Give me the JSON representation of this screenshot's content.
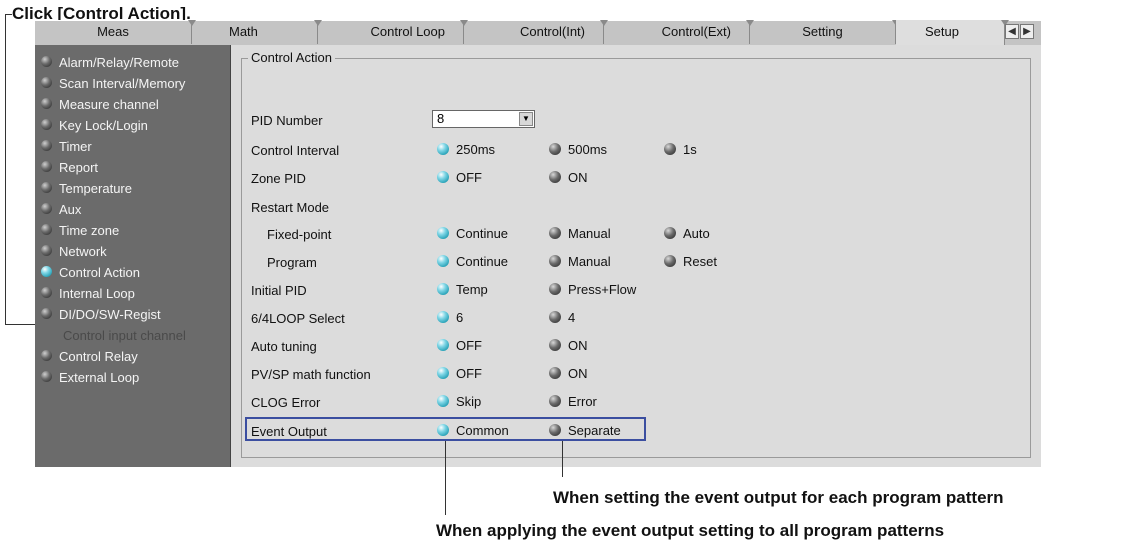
{
  "callouts": {
    "top": "Click [Control Action].",
    "separate": "When setting the event output for each program pattern",
    "common": "When applying the event output setting to all program patterns"
  },
  "tabs": [
    "Meas",
    "Math",
    "Control Loop",
    "Control(Int)",
    "Control(Ext)",
    "Setting",
    "Setup"
  ],
  "active_tab": "Setup",
  "menu": [
    {
      "label": "Alarm/Relay/Remote",
      "on": false
    },
    {
      "label": "Scan Interval/Memory",
      "on": false
    },
    {
      "label": "Measure channel",
      "on": false
    },
    {
      "label": "Key Lock/Login",
      "on": false
    },
    {
      "label": "Timer",
      "on": false
    },
    {
      "label": "Report",
      "on": false
    },
    {
      "label": "Temperature",
      "on": false
    },
    {
      "label": "Aux",
      "on": false
    },
    {
      "label": "Time zone",
      "on": false
    },
    {
      "label": "Network",
      "on": false
    },
    {
      "label": "Control Action",
      "on": true
    },
    {
      "label": "Internal Loop",
      "on": false
    },
    {
      "label": "DI/DO/SW-Regist",
      "on": false
    },
    {
      "label": "Control input channel",
      "disabled": true
    },
    {
      "label": "Control Relay",
      "on": false
    },
    {
      "label": "External Loop",
      "on": false
    }
  ],
  "group_title": "Control Action",
  "pid_number": {
    "label": "PID Number",
    "value": "8"
  },
  "rows": [
    {
      "label": "Control Interval",
      "options": [
        {
          "t": "250ms",
          "on": true
        },
        {
          "t": "500ms",
          "on": false
        },
        {
          "t": "1s",
          "on": false
        }
      ]
    },
    {
      "label": "Zone PID",
      "options": [
        {
          "t": "OFF",
          "on": true
        },
        {
          "t": "ON",
          "on": false
        }
      ]
    },
    {
      "label": "Restart Mode",
      "options": []
    },
    {
      "label": "Fixed-point",
      "indent": true,
      "options": [
        {
          "t": "Continue",
          "on": true
        },
        {
          "t": "Manual",
          "on": false
        },
        {
          "t": "Auto",
          "on": false
        }
      ]
    },
    {
      "label": "Program",
      "indent": true,
      "options": [
        {
          "t": "Continue",
          "on": true
        },
        {
          "t": "Manual",
          "on": false
        },
        {
          "t": "Reset",
          "on": false
        }
      ]
    },
    {
      "label": "Initial PID",
      "options": [
        {
          "t": "Temp",
          "on": true
        },
        {
          "t": "Press+Flow",
          "on": false
        }
      ]
    },
    {
      "label": "6/4LOOP Select",
      "options": [
        {
          "t": "6",
          "on": true
        },
        {
          "t": "4",
          "on": false
        }
      ]
    },
    {
      "label": "Auto tuning",
      "options": [
        {
          "t": "OFF",
          "on": true
        },
        {
          "t": "ON",
          "on": false
        }
      ]
    },
    {
      "label": "PV/SP math function",
      "options": [
        {
          "t": "OFF",
          "on": true
        },
        {
          "t": "ON",
          "on": false
        }
      ]
    },
    {
      "label": "CLOG Error",
      "options": [
        {
          "t": "Skip",
          "on": true
        },
        {
          "t": "Error",
          "on": false
        }
      ]
    },
    {
      "label": "Event Output",
      "options": [
        {
          "t": "Common",
          "on": true
        },
        {
          "t": "Separate",
          "on": false
        }
      ]
    }
  ]
}
